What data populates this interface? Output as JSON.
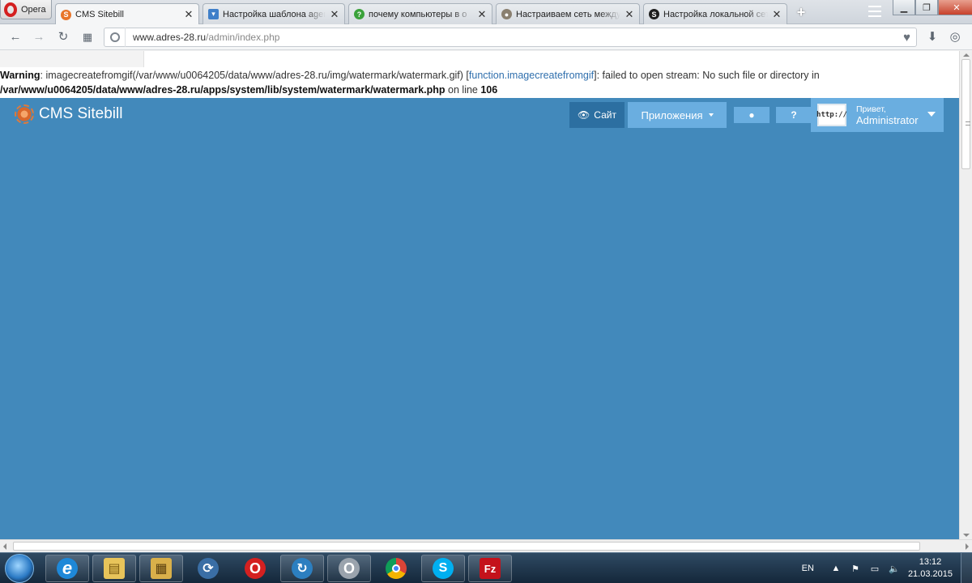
{
  "browser": {
    "menu_label": "Opera",
    "tabs": [
      {
        "title": "CMS Sitebill",
        "favicon_color": "#e8752a",
        "favicon_letter": "S"
      },
      {
        "title": "Настройка шаблона agent",
        "favicon_color": "#3f7fc9",
        "favicon_letter": "▾"
      },
      {
        "title": "почему компьютеры в о",
        "favicon_color": "#3aa23a",
        "favicon_letter": "?"
      },
      {
        "title": "Настраиваем сеть между",
        "favicon_color": "#8a8070",
        "favicon_letter": "●"
      },
      {
        "title": "Настройка локальной сети",
        "favicon_color": "#1e1e1e",
        "favicon_letter": "S"
      }
    ],
    "tab_close": "✕",
    "new_tab": "+",
    "url_domain": "www.adres-28.ru",
    "url_path": "/admin/index.php"
  },
  "warning": {
    "label": "Warning",
    "text1": ": imagecreatefromgif(/var/www/u0064205/data/www/adres-28.ru/img/watermark/watermark.gif) [",
    "function_link": "function.imagecreatefromgif",
    "text2": "]: failed to open stream: No such file or directory in",
    "path": "/var/www/u0064205/data/www/adres-28.ru/apps/system/lib/system/watermark/watermark.php",
    "on_line": " on line ",
    "line": "106"
  },
  "header": {
    "brand": "CMS Sitebill",
    "site_button": "Сайт",
    "apps_button": "Приложения",
    "greeting": "Привет,",
    "user_name": "Administrator",
    "avatar_text": "http://"
  },
  "colors": {
    "page_bg": "#4289bb",
    "header_btn": "#6aaee0",
    "site_btn": "#2c6fa1"
  },
  "taskbar": {
    "lang": "EN",
    "time": "13:12",
    "date": "21.03.2015",
    "apps": [
      {
        "name": "internet-explorer",
        "color": "#1e88d8",
        "glyph": "e"
      },
      {
        "name": "file-explorer",
        "color": "#e8c45a",
        "glyph": "▤"
      },
      {
        "name": "media-folder",
        "color": "#d9b04a",
        "glyph": "▦"
      },
      {
        "name": "network-app",
        "color": "#3a6ea5",
        "glyph": "⟳"
      },
      {
        "name": "opera-red",
        "color": "#d42020",
        "glyph": "O"
      },
      {
        "name": "sync-app",
        "color": "#2c7fc0",
        "glyph": "↻"
      },
      {
        "name": "opera-grey",
        "color": "#9aa3ad",
        "glyph": "O"
      },
      {
        "name": "chrome",
        "color": "#3c9a3c",
        "glyph": "◉"
      },
      {
        "name": "skype",
        "color": "#00aff0",
        "glyph": "S"
      },
      {
        "name": "filezilla",
        "color": "#c4121b",
        "glyph": "Fz"
      }
    ]
  }
}
